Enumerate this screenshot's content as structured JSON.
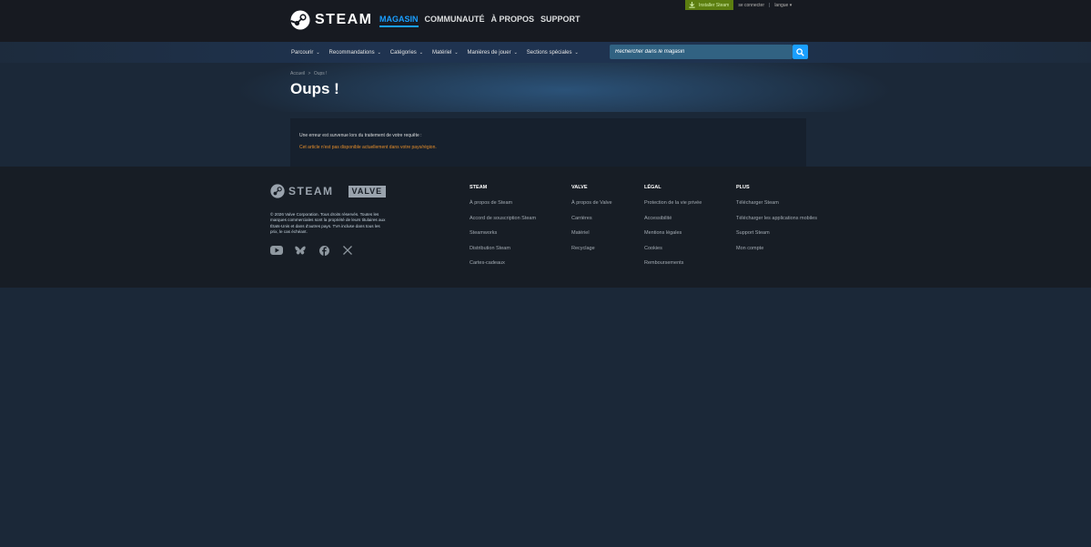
{
  "header": {
    "logo_text": "STEAM",
    "nav": [
      "MAGASIN",
      "COMMUNAUTÉ",
      "À PROPOS",
      "SUPPORT"
    ],
    "install_label": "Installer Steam",
    "login_label": "se connecter",
    "separator": "|",
    "language_label": "langue"
  },
  "store_nav": {
    "items": [
      "Parcourir",
      "Recommandations",
      "Catégories",
      "Matériel",
      "Manières de jouer",
      "Sections spéciales"
    ],
    "search_placeholder": "Rechercher dans le magasin"
  },
  "breadcrumb": {
    "home": "Accueil",
    "sep": ">",
    "current": "Oups !"
  },
  "page_title": "Oups !",
  "error": {
    "message": "Une erreur est survenue lors du traitement de votre requête :",
    "detail": "Cet article n'est pas disponible actuellement dans votre pays/région."
  },
  "footer": {
    "logo_text": "STEAM",
    "valve_logo": "VALVE",
    "copyright": "© 2026 Valve Corporation. Tous droits réservés. Toutes les marques commerciales sont la propriété de leurs titulaires aux États-Unis et dans d'autres pays. TVA incluse dans tous les prix, le cas échéant.",
    "social_icons": [
      "youtube-icon",
      "bluesky-icon",
      "facebook-icon",
      "x-icon"
    ],
    "columns": [
      {
        "title": "STEAM",
        "links": [
          "À propos de Steam",
          "Accord de souscription Steam",
          "Steamworks",
          "Distribution Steam",
          "Cartes-cadeaux"
        ]
      },
      {
        "title": "VALVE",
        "links": [
          "À propos de Valve",
          "Carrières",
          "Matériel",
          "Recyclage"
        ]
      },
      {
        "title": "LÉGAL",
        "links": [
          "Protection de la vie privée",
          "Accessibilité",
          "Mentions légales",
          "Cookies",
          "Remboursements"
        ]
      },
      {
        "title": "PLUS",
        "links": [
          "Télécharger Steam",
          "Télécharger les applications mobiles",
          "Support Steam",
          "Mon compte"
        ]
      }
    ]
  },
  "colors": {
    "background": "#1b2838",
    "header": "#171a21",
    "accent": "#1a9fff",
    "install": "#5c7e10",
    "error_detail": "#e58d2a",
    "footer": "#171d25"
  }
}
